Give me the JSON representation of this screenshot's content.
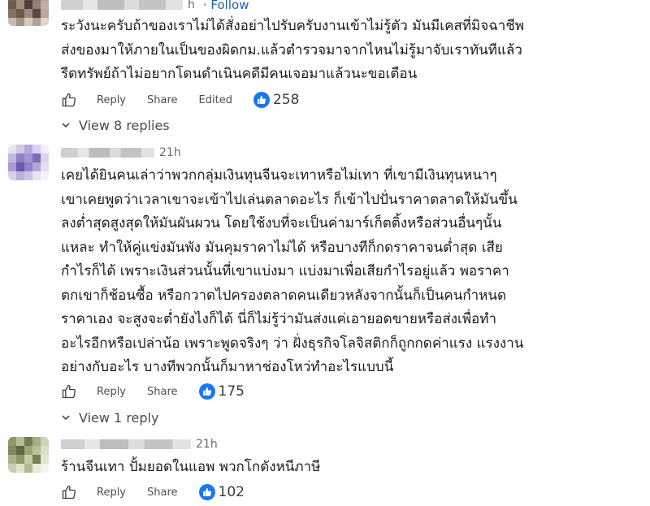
{
  "comments": [
    {
      "time": "h",
      "follow": "· Follow",
      "lines": [
        "ระวังนะครับถ้าของเราไม่ได้สั่งอย่าไปรับครับงานเข้าไม่รู้ตัว มันมีเคสที่มิจฉาชีพ",
        "ส่งของมาให้ภายในเป็นของผิดกม.แล้วตำรวจมาจากไหนไม่รู้มาจับเราทันทีแล้ว",
        "รีดทรัพย์ถ้าไม่อยากโดนดำเนินคดีมีคนเจอมาแล้วนะขอเตือน"
      ],
      "reply": "Reply",
      "share": "Share",
      "edited": "Edited",
      "likes": "258",
      "view_replies": "View 8 replies"
    },
    {
      "time": "21h",
      "lines": [
        "เคยได้ยินคนเล่าว่าพวกกลุ่มเงินทุนจีนจะเทาหรือไม่เทา ที่เขามีเงินทุนหนาๆ",
        "เขาเคยพูดว่าเวลาเขาจะเข้าไปเล่นตลาดอะไร ก็เข้าไปปั่นราคาตลาดให้มันขึ้น",
        "ลงต่ำสุดสูงสุดให้มันผันผวน โดยใช้งบที่จะเป็นค่ามาร์เก็ตติ้งหรือส่วนอื่นๆนั้น",
        "แหละ ทำให้คู่แข่งมันพัง มันคุมราคาไม่ได้ หรือบางทีก็กดราคาจนต่ำสุด เสีย",
        "กำไรก็ได้ เพราะเงินส่วนนั้นที่เขาแบ่งมา แบ่งมาเพื่อเสียกำไรอยู่แล้ว พอราคา",
        "ตกเขาก็ช้อนซื้อ หรือกวาดไปครองตลาดคนเดียวหลังจากนั้นก็เป็นคนกำหนด",
        "ราคาเอง จะสูงจะต่ำยังไงก็ได้ นี่ก็ไม่รู้ว่ามันส่งแค่เอายอดขายหรือส่งเพื่อทำ",
        "อะไรอีกหรือเปล่าน้อ เพราะพูดจริงๆ ว่า ฝั่งธุรกิจโลจิสติกก็ถูกกดค่าแรง แรงงาน",
        "อย่างกับอะไร บางทีพวกนั้นก็มาหาช่องโหว่ทำอะไรแบบนี้"
      ],
      "reply": "Reply",
      "share": "Share",
      "likes": "175",
      "view_replies": "View 1 reply"
    },
    {
      "time": "21h",
      "lines": [
        "ร้านจีนเทา ปั้มยอดในแอพ พวกโกดังหนีภาษี"
      ],
      "reply": "Reply",
      "share": "Share",
      "likes": "102"
    }
  ],
  "colors": {
    "like_blue": "#1877f2",
    "follow_blue": "#1f5fa8"
  },
  "icons": [
    "thumbs-up-icon",
    "like-badge-icon",
    "chevron-down-icon"
  ]
}
